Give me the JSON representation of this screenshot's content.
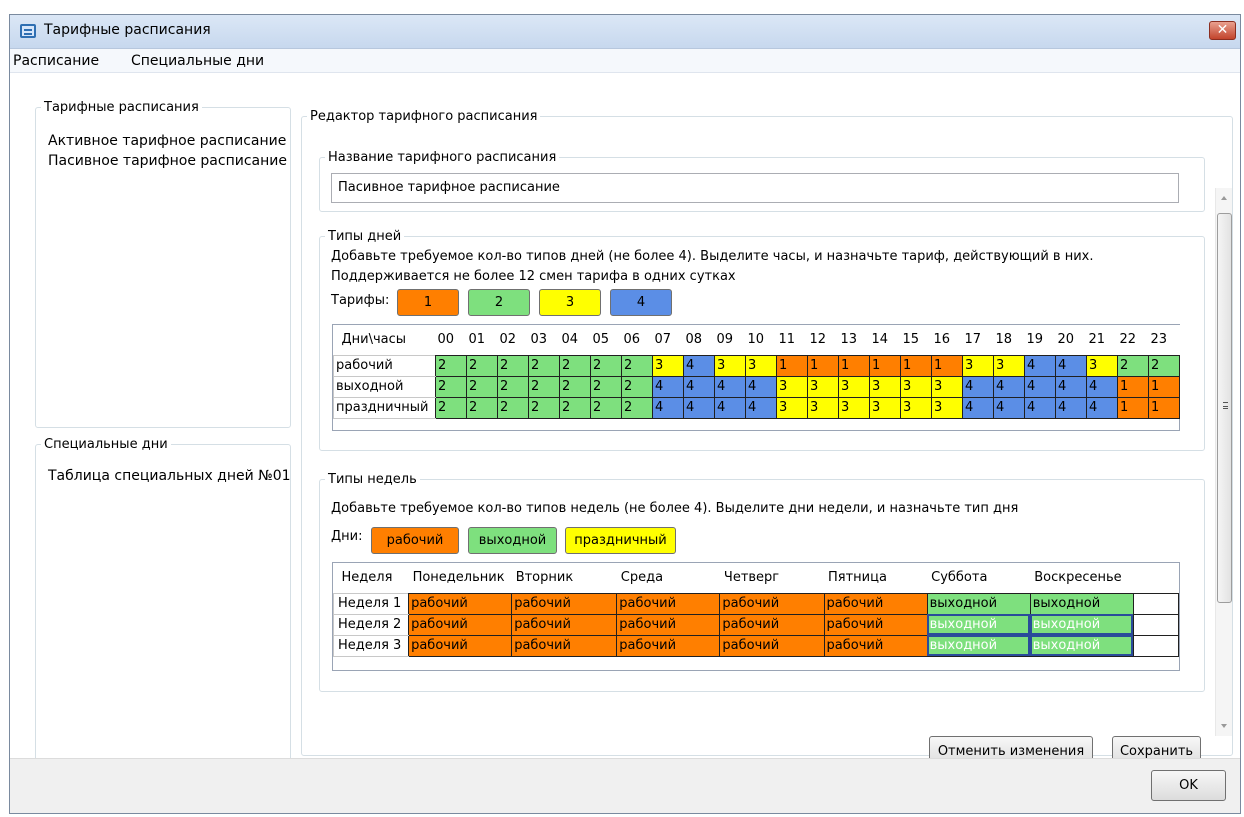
{
  "window": {
    "title": "Тарифные расписания",
    "close_label": "✕"
  },
  "menu": {
    "items": [
      "Расписание",
      "Специальные дни"
    ]
  },
  "left": {
    "schedules_legend": "Тарифные расписания",
    "schedules": [
      "Активное тарифное расписание",
      "Пасивное тарифное расписание"
    ],
    "special_legend": "Специальные дни",
    "special": [
      "Таблица специальных дней №01"
    ]
  },
  "editor": {
    "legend": "Редактор тарифного расписания",
    "name_legend": "Название тарифного расписания",
    "name_value": "Пасивное тарифное расписание",
    "day_types": {
      "legend": "Типы дней",
      "info1": "Добавьте требуемое кол-во типов дней (не более 4). Выделите часы, и назначьте тариф, действующий в них.",
      "info2": "Поддерживается не более 12 смен тарифа в одних сутках",
      "tariffs_label": "Тарифы:",
      "tariffs": [
        "1",
        "2",
        "3",
        "4"
      ],
      "corner": "Дни\\часы",
      "hours": [
        "00",
        "01",
        "02",
        "03",
        "04",
        "05",
        "06",
        "07",
        "08",
        "09",
        "10",
        "11",
        "12",
        "13",
        "14",
        "15",
        "16",
        "17",
        "18",
        "19",
        "20",
        "21",
        "22",
        "23"
      ],
      "rows": [
        {
          "name": "рабочий",
          "values": [
            "2",
            "2",
            "2",
            "2",
            "2",
            "2",
            "2",
            "3",
            "4",
            "3",
            "3",
            "1",
            "1",
            "1",
            "1",
            "1",
            "1",
            "3",
            "3",
            "4",
            "4",
            "3",
            "2",
            "2"
          ]
        },
        {
          "name": "выходной",
          "values": [
            "2",
            "2",
            "2",
            "2",
            "2",
            "2",
            "2",
            "4",
            "4",
            "4",
            "4",
            "3",
            "3",
            "3",
            "3",
            "3",
            "3",
            "4",
            "4",
            "4",
            "4",
            "4",
            "1",
            "1"
          ]
        },
        {
          "name": "праздничный",
          "values": [
            "2",
            "2",
            "2",
            "2",
            "2",
            "2",
            "2",
            "4",
            "4",
            "4",
            "4",
            "3",
            "3",
            "3",
            "3",
            "3",
            "3",
            "4",
            "4",
            "4",
            "4",
            "4",
            "1",
            "1"
          ]
        }
      ]
    },
    "week_types": {
      "legend": "Типы недель",
      "info": "Добавьте требуемое кол-во типов недель (не более 4). Выделите дни недели, и назначьте тип дня",
      "days_label": "Дни:",
      "day_types": [
        "рабочий",
        "выходной",
        "праздничный"
      ],
      "columns": [
        "Неделя",
        "Понедельник",
        "Вторник",
        "Среда",
        "Четверг",
        "Пятница",
        "Суббота",
        "Воскресенье"
      ],
      "rows": [
        {
          "name": "Неделя 1",
          "values": [
            "рабочий",
            "рабочий",
            "рабочий",
            "рабочий",
            "рабочий",
            "выходной",
            "выходной"
          ]
        },
        {
          "name": "Неделя 2",
          "values": [
            "рабочий",
            "рабочий",
            "рабочий",
            "рабочий",
            "рабочий",
            "выходной",
            "выходной"
          ]
        },
        {
          "name": "Неделя 3",
          "values": [
            "рабочий",
            "рабочий",
            "рабочий",
            "рабочий",
            "рабочий",
            "выходной",
            "выходной"
          ]
        }
      ]
    },
    "cancel_label": "Отменить изменения",
    "save_label": "Сохранить"
  },
  "footer": {
    "ok_label": "OK"
  },
  "colors": {
    "tariff_1": "#ff7f00",
    "tariff_2": "#7ee07e",
    "tariff_3": "#ffff00",
    "tariff_4": "#5b8ee6"
  }
}
